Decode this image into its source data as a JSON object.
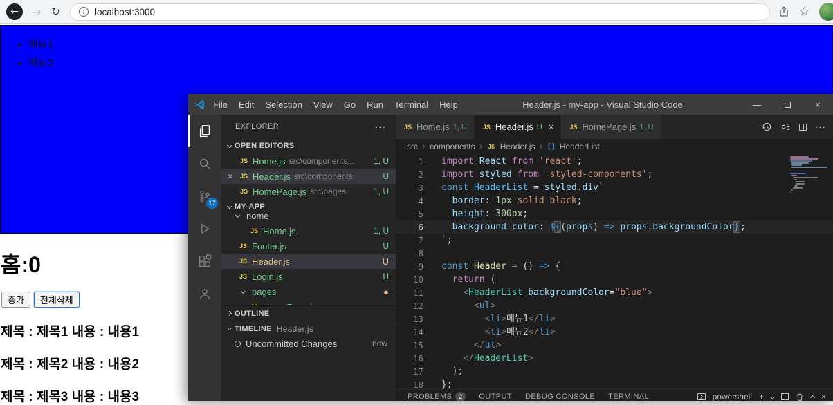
{
  "browser": {
    "url": "localhost:3000"
  },
  "page": {
    "header_bg": "#0000ff",
    "menu_items": [
      "메뉴1",
      "메뉴2"
    ],
    "counter_text": "홈:0",
    "increase_button": "증가",
    "clear_button": "전체삭제",
    "posts": [
      "제목 : 제목1 내용 : 내용1",
      "제목 : 제목2 내용 : 내용2",
      "제목 : 제목3 내용 : 내용3"
    ]
  },
  "icons": {
    "back": "←",
    "forward": "→",
    "reload": "↻",
    "info": "i",
    "star": "☆",
    "close": "×",
    "minimize": "—",
    "more": "···",
    "separator": "›",
    "js": "JS",
    "plus": "+",
    "brackets": "[]"
  },
  "vscode": {
    "title": "Header.js - my-app - Visual Studio Code",
    "menus": [
      "File",
      "Edit",
      "Selection",
      "View",
      "Go",
      "Run",
      "Terminal",
      "Help"
    ],
    "activity": {
      "scm_badge": "17"
    },
    "sidebar": {
      "title": "EXPLORER",
      "open_editors_label": "OPEN EDITORS",
      "open_editors": [
        {
          "name": "Home.js",
          "desc": "src\\components...",
          "badge": "1, U"
        },
        {
          "name": "Header.js",
          "desc": "src\\components",
          "badge": "U"
        },
        {
          "name": "HomePage.js",
          "desc": "src\\pages",
          "badge": "1, U"
        }
      ],
      "project_label": "MY-APP",
      "tree": [
        {
          "name": "home"
        },
        {
          "name": "Home.js",
          "badge": "1, U"
        },
        {
          "name": "Footer.js",
          "badge": "U"
        },
        {
          "name": "Header.js",
          "badge": "U"
        },
        {
          "name": "Login.js",
          "badge": "U"
        },
        {
          "name": "pages",
          "badge": "●"
        },
        {
          "name": "HomePage.js",
          "badge": ""
        }
      ],
      "outline_label": "OUTLINE",
      "timeline_label": "TIMELINE",
      "timeline_file": "Header.js",
      "timeline_entry": "Uncommitted Changes",
      "timeline_time": "now"
    },
    "tabs": [
      {
        "name": "Home.js",
        "badge": "1, U"
      },
      {
        "name": "Header.js",
        "badge": "U"
      },
      {
        "name": "HomePage.js",
        "badge": "1, U"
      }
    ],
    "breadcrumb": [
      "src",
      "components",
      "Header.js",
      "HeaderList"
    ],
    "code_lines": [
      {
        "tokens": [
          [
            "kw2",
            "import "
          ],
          [
            "var",
            "React "
          ],
          [
            "kw2",
            "from "
          ],
          [
            "str",
            "'react'"
          ],
          [
            "txt",
            ";"
          ]
        ]
      },
      {
        "tokens": [
          [
            "kw2",
            "import "
          ],
          [
            "var",
            "styled "
          ],
          [
            "kw2",
            "from "
          ],
          [
            "str",
            "'styled-components'"
          ],
          [
            "txt",
            ";"
          ]
        ]
      },
      {
        "tokens": [
          [
            "kw",
            "const "
          ],
          [
            "cst",
            "HeaderList "
          ],
          [
            "txt",
            "= "
          ],
          [
            "var",
            "styled"
          ],
          [
            "txt",
            "."
          ],
          [
            "var",
            "div"
          ],
          [
            "str",
            "`"
          ]
        ]
      },
      {
        "tokens": [
          [
            "txt",
            "  "
          ],
          [
            "var",
            "border"
          ],
          [
            "txt",
            ": "
          ],
          [
            "num",
            "1px "
          ],
          [
            "str",
            "solid black"
          ],
          [
            "txt",
            ";"
          ]
        ]
      },
      {
        "tokens": [
          [
            "txt",
            "  "
          ],
          [
            "var",
            "height"
          ],
          [
            "txt",
            ": "
          ],
          [
            "num",
            "300px"
          ],
          [
            "txt",
            ";"
          ]
        ]
      },
      {
        "current": true,
        "tokens": [
          [
            "txt",
            "  "
          ],
          [
            "var",
            "background-color"
          ],
          [
            "txt",
            ": "
          ],
          [
            "kw",
            "$"
          ],
          [
            "kw bhl",
            "{"
          ],
          [
            "txt",
            "("
          ],
          [
            "var",
            "props"
          ],
          [
            "txt",
            ") "
          ],
          [
            "kw",
            "=> "
          ],
          [
            "var",
            "props"
          ],
          [
            "txt",
            "."
          ],
          [
            "var",
            "backgroundColor"
          ],
          [
            "kw bhl",
            "}"
          ],
          [
            "cursor",
            ""
          ],
          [
            "txt",
            ";"
          ]
        ]
      },
      {
        "tokens": [
          [
            "str",
            "`"
          ],
          [
            "txt",
            ";"
          ]
        ]
      },
      {
        "tokens": []
      },
      {
        "tokens": [
          [
            "kw",
            "const "
          ],
          [
            "fn",
            "Header "
          ],
          [
            "txt",
            "= () "
          ],
          [
            "kw",
            "=> "
          ],
          [
            "txt",
            "{"
          ]
        ]
      },
      {
        "tokens": [
          [
            "txt",
            "  "
          ],
          [
            "kw2",
            "return"
          ],
          [
            "txt",
            " ("
          ]
        ]
      },
      {
        "tokens": [
          [
            "txt",
            "    "
          ],
          [
            "pun",
            "<"
          ],
          [
            "cls",
            "HeaderList "
          ],
          [
            "var",
            "backgroundColor"
          ],
          [
            "txt",
            "="
          ],
          [
            "str",
            "\"blue\""
          ],
          [
            "pun",
            ">"
          ]
        ]
      },
      {
        "tokens": [
          [
            "txt",
            "      "
          ],
          [
            "pun",
            "<"
          ],
          [
            "tag",
            "ul"
          ],
          [
            "pun",
            ">"
          ]
        ]
      },
      {
        "tokens": [
          [
            "txt",
            "        "
          ],
          [
            "pun",
            "<"
          ],
          [
            "tag",
            "li"
          ],
          [
            "pun",
            ">"
          ],
          [
            "txt",
            "메뉴1"
          ],
          [
            "pun",
            "</"
          ],
          [
            "tag",
            "li"
          ],
          [
            "pun",
            ">"
          ]
        ]
      },
      {
        "tokens": [
          [
            "txt",
            "        "
          ],
          [
            "pun",
            "<"
          ],
          [
            "tag",
            "li"
          ],
          [
            "pun",
            ">"
          ],
          [
            "txt",
            "메뉴2"
          ],
          [
            "pun",
            "</"
          ],
          [
            "tag",
            "li"
          ],
          [
            "pun",
            ">"
          ]
        ]
      },
      {
        "tokens": [
          [
            "txt",
            "      "
          ],
          [
            "pun",
            "</"
          ],
          [
            "tag",
            "ul"
          ],
          [
            "pun",
            ">"
          ]
        ]
      },
      {
        "tokens": [
          [
            "txt",
            "    "
          ],
          [
            "pun",
            "</"
          ],
          [
            "cls",
            "HeaderList"
          ],
          [
            "pun",
            ">"
          ]
        ]
      },
      {
        "tokens": [
          [
            "txt",
            "  "
          ],
          [
            "txt",
            ");"
          ]
        ]
      },
      {
        "tokens": [
          [
            "txt",
            "};"
          ]
        ]
      }
    ],
    "panel": {
      "tabs": [
        "PROBLEMS",
        "OUTPUT",
        "DEBUG CONSOLE",
        "TERMINAL"
      ],
      "problems_badge": "2",
      "shell": "powershell"
    }
  }
}
